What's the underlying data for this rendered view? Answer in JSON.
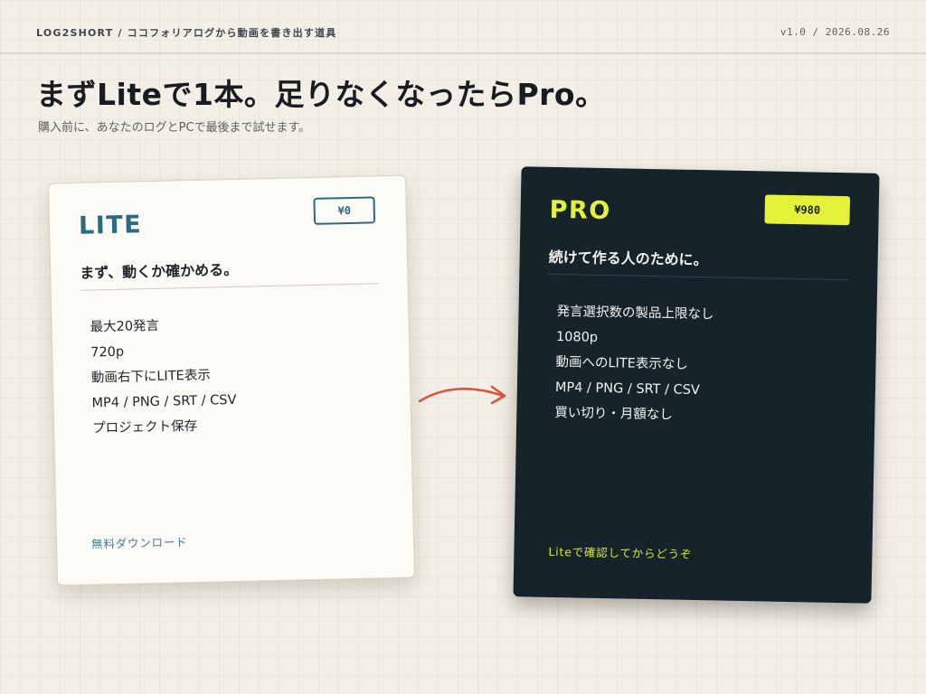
{
  "header": {
    "brand": "LOG2SHORT / ココフォリアログから動画を書き出す道具",
    "version": "v1.0 / 2026.08.26"
  },
  "hero": {
    "headline": "まずLiteで1本。足りなくなったらPro。",
    "subline": "購入前に、あなたのログとPCで最後まで試せます。"
  },
  "plans": {
    "lite": {
      "name": "LITE",
      "price": "¥0",
      "tagline": "まず、動くか確かめる。",
      "features": [
        "最大20発言",
        "720p",
        "動画右下にLITE表示",
        "MP4 / PNG / SRT / CSV",
        "プロジェクト保存"
      ],
      "cta": "無料ダウンロード"
    },
    "pro": {
      "name": "PRO",
      "price": "¥980",
      "tagline": "続けて作る人のために。",
      "features": [
        "発言選択数の製品上限なし",
        "1080p",
        "動画へのLITE表示なし",
        "MP4 / PNG / SRT / CSV",
        "買い切り・月額なし"
      ],
      "cta": "Liteで確認してからどうぞ"
    }
  },
  "colors": {
    "background": "#f3efe6",
    "lite_accent": "#2b6b82",
    "pro_background": "#17232b",
    "pro_accent": "#e5f23a",
    "arrow": "#e0503c"
  },
  "icons": {
    "connector": "curved-arrow-right-icon"
  }
}
